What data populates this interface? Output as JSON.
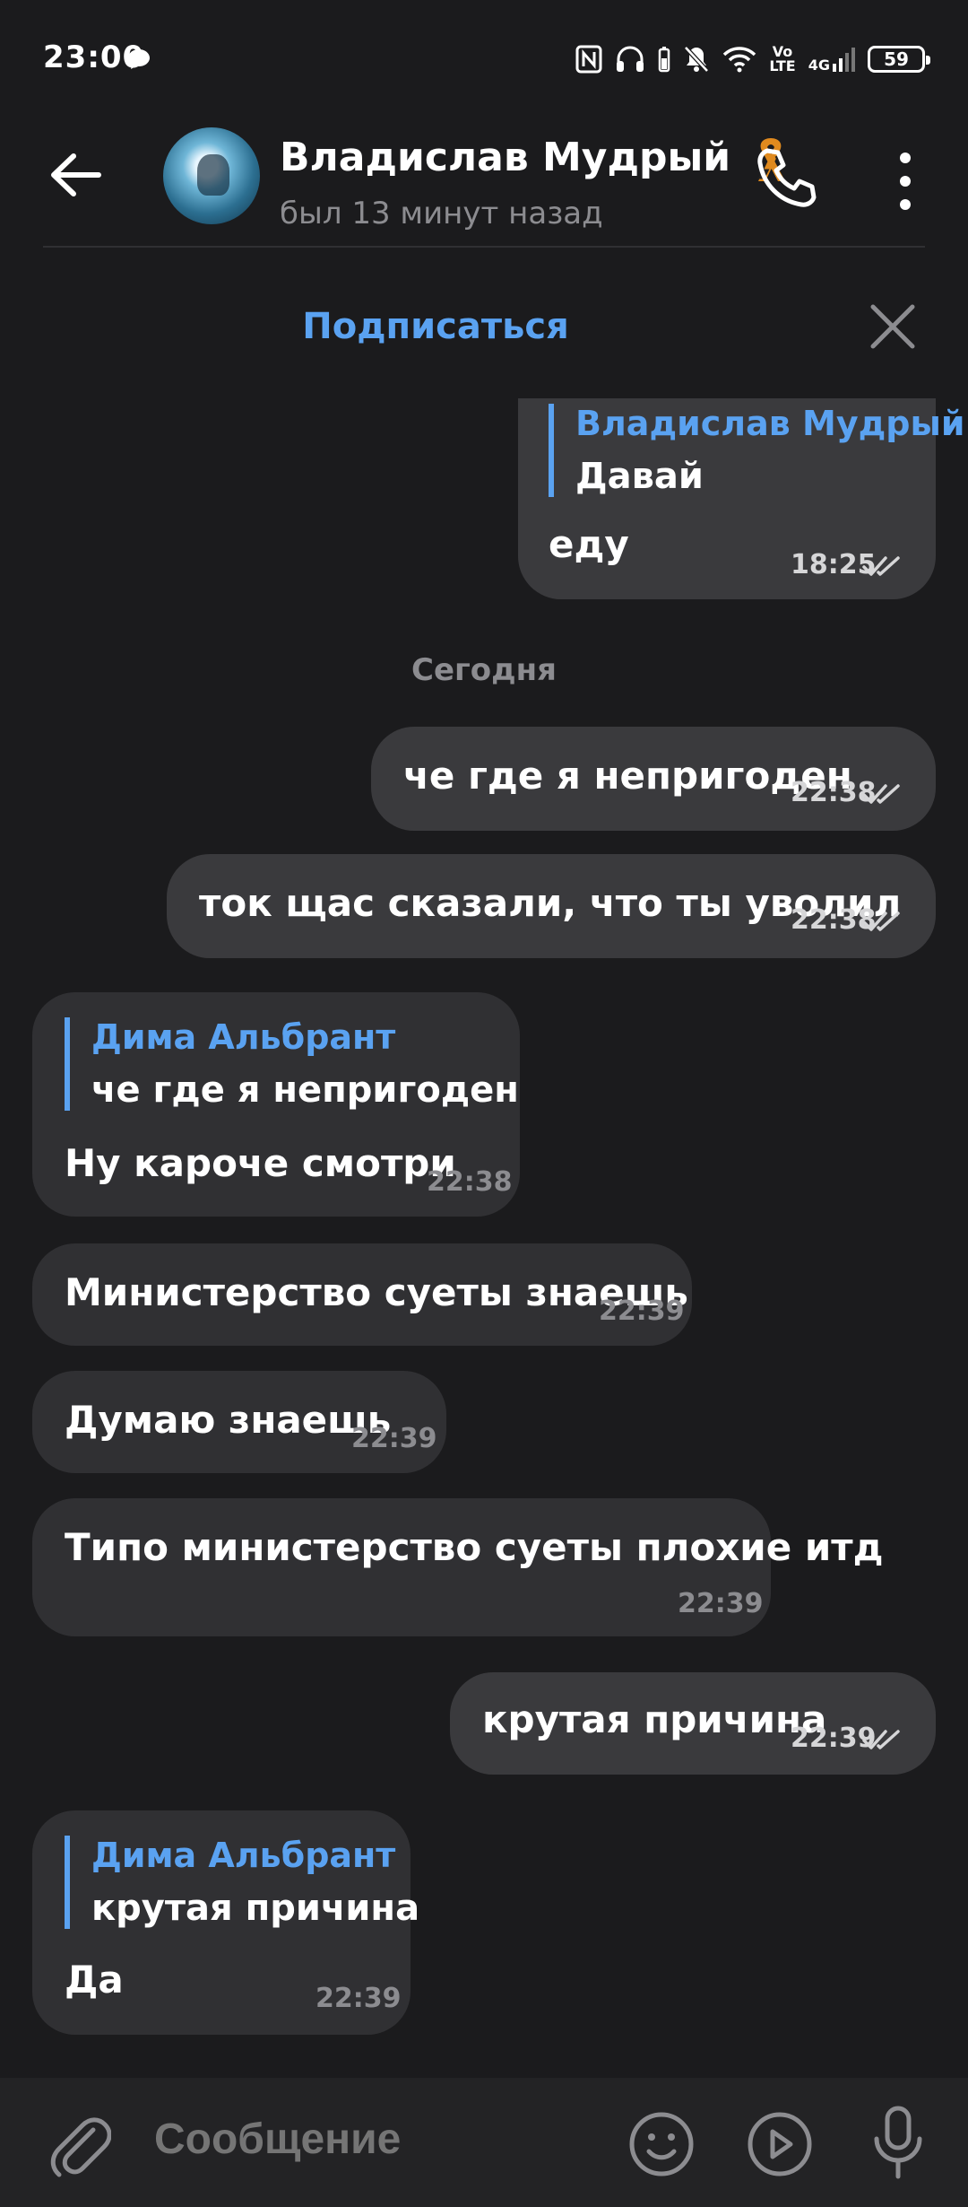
{
  "status_bar": {
    "time": "23:00",
    "network_volte": "Vo\nLTE",
    "network_4g": "4G",
    "battery": "59"
  },
  "header": {
    "contact_name": "Владислав Мудрый",
    "contact_status": "был 13 минут назад"
  },
  "subscribe": {
    "label": "Подписаться"
  },
  "date_separator": "Сегодня",
  "messages": [
    {
      "direction": "out",
      "reply_name": "Владислав Мудрый",
      "reply_text": "Давай",
      "text": "еду",
      "time": "18:25",
      "read": true
    },
    {
      "direction": "out",
      "text": "че где я непригоден",
      "time": "22:38",
      "read": true
    },
    {
      "direction": "out",
      "text": "ток щас сказали, что ты уволил",
      "time": "22:38",
      "read": true
    },
    {
      "direction": "in",
      "reply_name": "Дима Альбрант",
      "reply_text": "че где я непригоден",
      "text": "Ну кароче смотри",
      "time": "22:38"
    },
    {
      "direction": "in",
      "text": "Министерство суеты знаешь",
      "time": "22:39"
    },
    {
      "direction": "in",
      "text": "Думаю знаешь",
      "time": "22:39"
    },
    {
      "direction": "in",
      "text": "Типо министерство суеты плохие итд",
      "time": "22:39"
    },
    {
      "direction": "out",
      "text": "крутая причина",
      "time": "22:39",
      "read": true
    },
    {
      "direction": "in",
      "reply_name": "Дима Альбрант",
      "reply_text": "крутая причина",
      "text": "Да",
      "time": "22:39"
    }
  ],
  "composer": {
    "placeholder": "Сообщение"
  },
  "icons": {
    "status": [
      "chat-bubble-icon",
      "nfc-icon",
      "headset-icon",
      "mute-bell-icon",
      "wifi-icon",
      "signal-icon",
      "battery-icon"
    ],
    "header": [
      "back-arrow-icon",
      "phone-icon",
      "more-vert-icon"
    ],
    "composer": [
      "paperclip-icon",
      "emoji-icon",
      "video-message-icon",
      "microphone-icon"
    ]
  },
  "colors": {
    "background": "#1b1b1d",
    "accent": "#5aa2f1",
    "bubble_out": "#3a3a3d",
    "bubble_in": "#303033",
    "muted": "#8c8c90"
  }
}
